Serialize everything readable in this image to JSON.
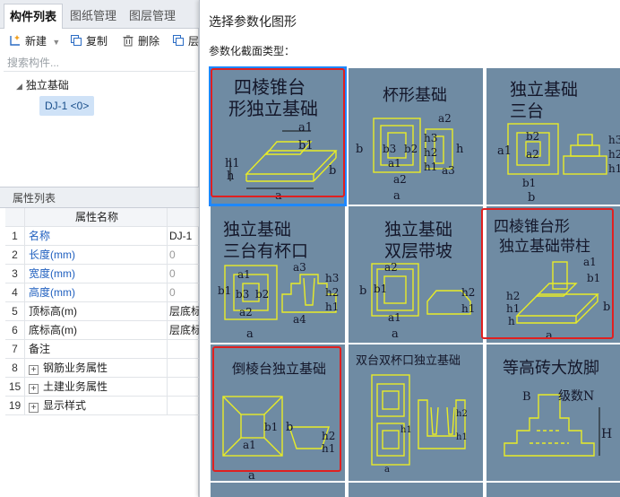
{
  "tabs": [
    "构件列表",
    "图纸管理",
    "图层管理"
  ],
  "toolbar": {
    "new": "新建",
    "copy": "复制",
    "delete": "删除",
    "layer": "层"
  },
  "search": {
    "placeholder": "搜索构件..."
  },
  "tree": {
    "root": "独立基础",
    "item": "DJ-1 <0>"
  },
  "properties": {
    "title": "属性列表",
    "header": "属性名称",
    "rows": [
      {
        "num": "1",
        "name": "名称",
        "value": "DJ-1"
      },
      {
        "num": "2",
        "name": "长度(mm)",
        "value": "0"
      },
      {
        "num": "3",
        "name": "宽度(mm)",
        "value": "0"
      },
      {
        "num": "4",
        "name": "高度(mm)",
        "value": "0"
      },
      {
        "num": "5",
        "name": "顶标高(m)",
        "value": "层底标"
      },
      {
        "num": "6",
        "name": "底标高(m)",
        "value": "层底标"
      },
      {
        "num": "7",
        "name": "备注",
        "value": ""
      },
      {
        "num": "8",
        "name": "钢筋业务属性",
        "value": ""
      },
      {
        "num": "15",
        "name": "土建业务属性",
        "value": ""
      },
      {
        "num": "19",
        "name": "显示样式",
        "value": ""
      }
    ]
  },
  "dialog": {
    "title": "选择参数化图形",
    "subtitle": "参数化截面类型：",
    "shapes": [
      {
        "title1": "四棱锥台",
        "title2": "形独立基础"
      },
      {
        "title1": "杯形基础",
        "title2": ""
      },
      {
        "title1": "独立基础",
        "title2": "三台"
      },
      {
        "title1": "独立基础",
        "title2": "三台有杯口"
      },
      {
        "title1": "独立基础",
        "title2": "双层带坡"
      },
      {
        "title1": "四棱锥台形",
        "title2": "独立基础带柱"
      },
      {
        "title1": "倒棱台独立基础",
        "title2": ""
      },
      {
        "title1": "双台双杯口独立基础",
        "title2": ""
      },
      {
        "title1": "等高砖大放脚",
        "title2": ""
      }
    ],
    "dim_labels": {
      "a": "a",
      "b": "b",
      "a1": "a1",
      "b1": "b1",
      "h": "h",
      "h1": "h1",
      "h2": "h2",
      "h3": "h3",
      "a2": "a2",
      "b2": "b2",
      "a3": "a3",
      "b3": "b3",
      "a4": "a4",
      "B": "B",
      "N": "级数N",
      "H": "H"
    }
  },
  "colors": {
    "accent_blue": "#1e88ff",
    "highlight_red": "#e02020",
    "tile_bg": "#6f8ba3",
    "drawing_yellow": "#e8ec27"
  }
}
